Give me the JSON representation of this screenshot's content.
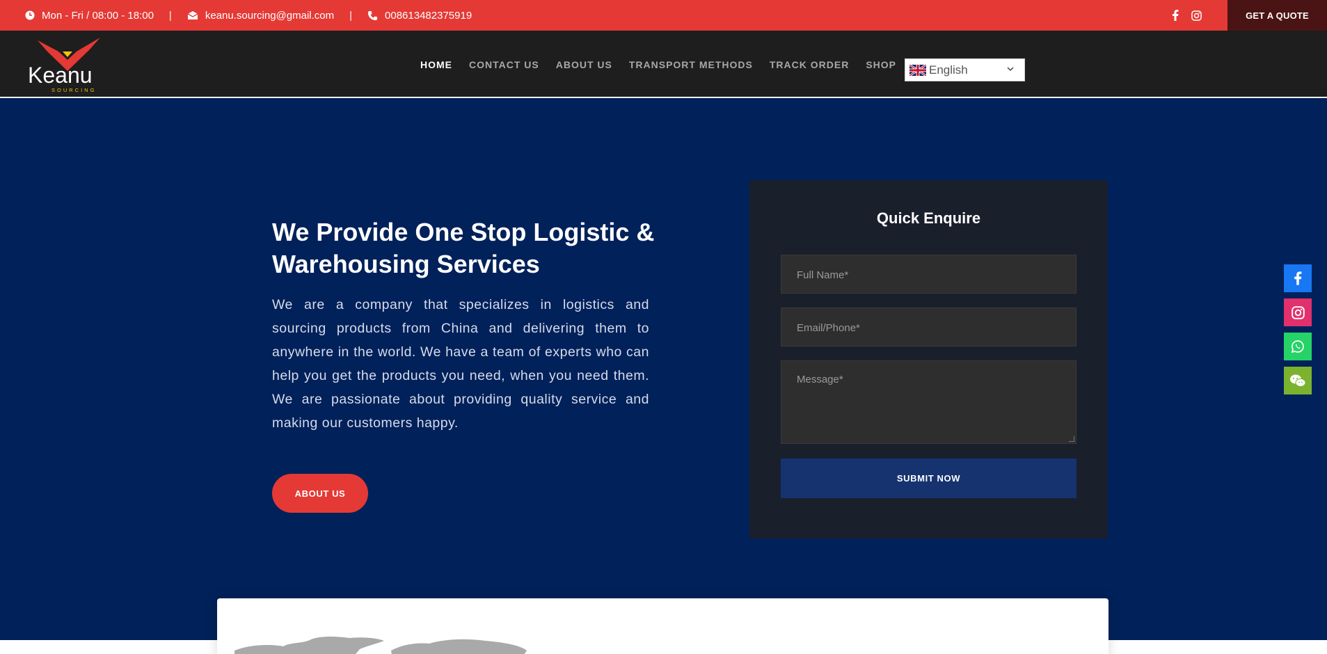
{
  "topbar": {
    "hours": "Mon - Fri / 08:00 - 18:00",
    "email": "keanu.sourcing@gmail.com",
    "phone": "008613482375919",
    "separator": "|",
    "social_icons": [
      "facebook-icon",
      "instagram-icon"
    ],
    "quote_label": "GET A QUOTE",
    "bg_color": "#e53935"
  },
  "header": {
    "logo_text": "Keanu",
    "logo_subtext": "SOURCING",
    "nav": [
      {
        "label": "HOME",
        "active": true
      },
      {
        "label": "CONTACT US",
        "active": false
      },
      {
        "label": "ABOUT US",
        "active": false
      },
      {
        "label": "TRANSPORT METHODS",
        "active": false
      },
      {
        "label": "TRACK ORDER",
        "active": false
      },
      {
        "label": "SHOP",
        "active": false
      }
    ],
    "language": "English"
  },
  "hero": {
    "title": "We Provide One Stop Logistic & Warehousing Services",
    "text": "We are a company that specializes in logistics and sourcing products from China and delivering them to anywhere in the world. We have a team of experts who can help you get the products you need, when you need them. We are passionate about providing quality service and making our customers happy.",
    "button_label": "ABOUT US",
    "bg_color": "#00215a"
  },
  "form": {
    "title": "Quick Enquire",
    "name_placeholder": "Full Name*",
    "email_placeholder": "Email/Phone*",
    "message_placeholder": "Message*",
    "submit_label": "SUBMIT NOW"
  },
  "float_social": [
    "facebook-icon",
    "instagram-icon",
    "whatsapp-icon",
    "wechat-icon"
  ]
}
